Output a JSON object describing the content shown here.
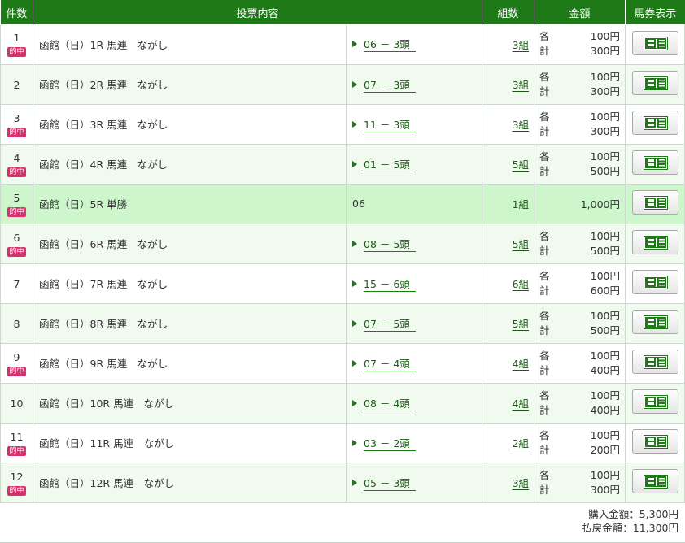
{
  "headers": {
    "count": "件数",
    "content": "投票内容",
    "kumi": "組数",
    "amount": "金額",
    "ticket": "馬券表示"
  },
  "rows": [
    {
      "num": "1",
      "hit": "的中",
      "content": "函館（日）1R 馬連　ながし",
      "combo": "06 － 3頭",
      "kumi": "3組",
      "each_label": "各",
      "each": "100円",
      "total_label": "計",
      "total": "300円"
    },
    {
      "num": "2",
      "hit": "",
      "content": "函館（日）2R 馬連　ながし",
      "combo": "07 － 3頭",
      "kumi": "3組",
      "each_label": "各",
      "each": "100円",
      "total_label": "計",
      "total": "300円"
    },
    {
      "num": "3",
      "hit": "的中",
      "content": "函館（日）3R 馬連　ながし",
      "combo": "11 － 3頭",
      "kumi": "3組",
      "each_label": "各",
      "each": "100円",
      "total_label": "計",
      "total": "300円"
    },
    {
      "num": "4",
      "hit": "的中",
      "content": "函館（日）4R 馬連　ながし",
      "combo": "01 － 5頭",
      "kumi": "5組",
      "each_label": "各",
      "each": "100円",
      "total_label": "計",
      "total": "500円"
    },
    {
      "num": "5",
      "hit": "的中",
      "content": "函館（日）5R 単勝",
      "combo": "06",
      "kumi": "1組",
      "each_label": "",
      "each": "",
      "total_label": "",
      "total": "1,000円",
      "single": true,
      "highlight": true
    },
    {
      "num": "6",
      "hit": "的中",
      "content": "函館（日）6R 馬連　ながし",
      "combo": "08 － 5頭",
      "kumi": "5組",
      "each_label": "各",
      "each": "100円",
      "total_label": "計",
      "total": "500円"
    },
    {
      "num": "7",
      "hit": "",
      "content": "函館（日）7R 馬連　ながし",
      "combo": "15 － 6頭",
      "kumi": "6組",
      "each_label": "各",
      "each": "100円",
      "total_label": "計",
      "total": "600円"
    },
    {
      "num": "8",
      "hit": "",
      "content": "函館（日）8R 馬連　ながし",
      "combo": "07 － 5頭",
      "kumi": "5組",
      "each_label": "各",
      "each": "100円",
      "total_label": "計",
      "total": "500円"
    },
    {
      "num": "9",
      "hit": "的中",
      "content": "函館（日）9R 馬連　ながし",
      "combo": "07 － 4頭",
      "kumi": "4組",
      "each_label": "各",
      "each": "100円",
      "total_label": "計",
      "total": "400円"
    },
    {
      "num": "10",
      "hit": "",
      "content": "函館（日）10R 馬連　ながし",
      "combo": "08 － 4頭",
      "kumi": "4組",
      "each_label": "各",
      "each": "100円",
      "total_label": "計",
      "total": "400円"
    },
    {
      "num": "11",
      "hit": "的中",
      "content": "函館（日）11R 馬連　ながし",
      "combo": "03 － 2頭",
      "kumi": "2組",
      "each_label": "各",
      "each": "100円",
      "total_label": "計",
      "total": "200円"
    },
    {
      "num": "12",
      "hit": "的中",
      "content": "函館（日）12R 馬連　ながし",
      "combo": "05 － 3頭",
      "kumi": "3組",
      "each_label": "各",
      "each": "100円",
      "total_label": "計",
      "total": "300円"
    }
  ],
  "summary": {
    "purchase": "購入金額：5,300円",
    "payout": "払戻金額：11,300円"
  },
  "colors": {
    "header_bg": "#1d7a17",
    "hit_badge": "#d6306d",
    "row_highlight": "#cdf6cd",
    "row_alt": "#f1faef"
  },
  "icons": {
    "ticket": "ticket-icon",
    "combo_marker": "triangle-right-icon"
  }
}
